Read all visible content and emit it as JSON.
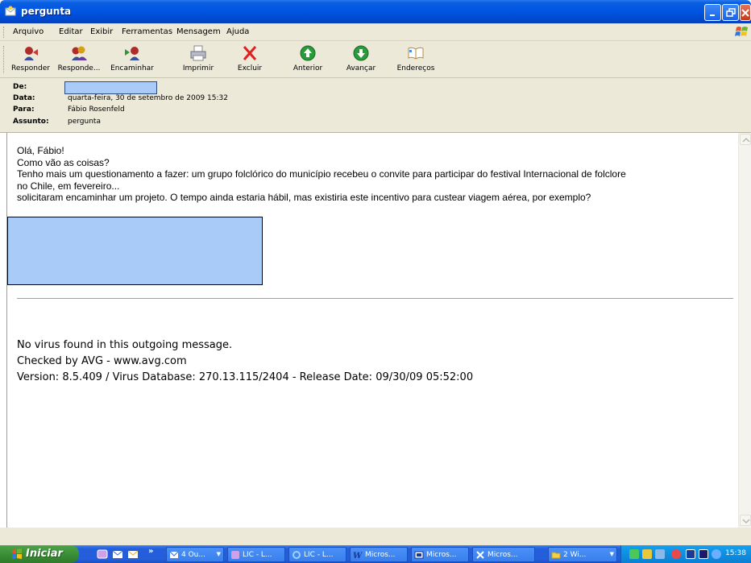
{
  "window": {
    "title": "pergunta",
    "colors": {
      "titlebar": "#0054e3",
      "chrome": "#ece9d8",
      "redaction": "#a8cbf7"
    }
  },
  "menu": {
    "items": [
      "Arquivo",
      "Editar",
      "Exibir",
      "Ferramentas",
      "Mensagem",
      "Ajuda"
    ]
  },
  "toolbar": {
    "buttons": [
      {
        "label": "Responder",
        "icon": "reply-icon"
      },
      {
        "label": "Responde...",
        "icon": "reply-all-icon"
      },
      {
        "label": "Encaminhar",
        "icon": "forward-icon"
      },
      {
        "label": "Imprimir",
        "icon": "printer-icon"
      },
      {
        "label": "Excluir",
        "icon": "delete-x-icon"
      },
      {
        "label": "Anterior",
        "icon": "up-arrow-icon"
      },
      {
        "label": "Avançar",
        "icon": "down-arrow-icon"
      },
      {
        "label": "Endereços",
        "icon": "address-book-icon"
      }
    ]
  },
  "header": {
    "de_label": "De:",
    "data_label": "Data:",
    "data_value": "quarta-feira, 30 de setembro de 2009 15:32",
    "para_label": "Para:",
    "para_value": "Fábio Rosenfeld",
    "assunto_label": "Assunto:",
    "assunto_value": "pergunta"
  },
  "message": {
    "lines": [
      "Olá, Fábio!",
      "Como vão as coisas?",
      "Tenho mais um questionamento a fazer: um grupo folclórico do município recebeu o convite para participar do festival Internacional de folclore",
      "no Chile, em fevereiro...",
      "solicitaram encaminhar um projeto. O tempo ainda estaria hábil, mas existiria este incentivo para custear viagem aérea, por exemplo?"
    ],
    "avg_lines": [
      "No virus found in this outgoing message.",
      "Checked by AVG - www.avg.com",
      "Version: 8.5.409 / Virus Database: 270.13.115/2404 - Release Date: 09/30/09 05:52:00"
    ]
  },
  "taskbar": {
    "start_label": "Iniciar",
    "more_label": "»",
    "tasks": [
      {
        "label": "4 Ou...",
        "icon": "outlook-icon",
        "has_arrow": true
      },
      {
        "label": "LIC - L...",
        "icon": "browser-icon",
        "has_arrow": false
      },
      {
        "label": "LIC - L...",
        "icon": "ie-icon",
        "has_arrow": false
      },
      {
        "label": "Micros...",
        "icon": "word-icon",
        "has_arrow": false
      },
      {
        "label": "Micros...",
        "icon": "presentation-icon",
        "has_arrow": false
      },
      {
        "label": "Micros...",
        "icon": "excel-icon",
        "has_arrow": false
      },
      {
        "label": "2 Wi...",
        "icon": "folder-icon",
        "has_arrow": true
      }
    ],
    "clock": "15:38"
  }
}
